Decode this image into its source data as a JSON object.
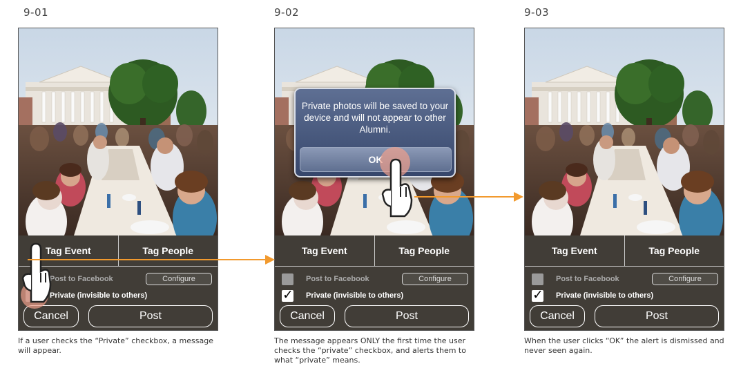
{
  "panels": [
    {
      "label": "9-01",
      "tag_event": "Tag Event",
      "tag_people": "Tag People",
      "post_to_facebook": "Post to Facebook",
      "configure": "Configure",
      "private": "Private (invisible to others)",
      "private_checked": false,
      "cancel": "Cancel",
      "post": "Post",
      "caption": "If a user checks the “Private” checkbox, a message will appear."
    },
    {
      "label": "9-02",
      "tag_event": "Tag Event",
      "tag_people": "Tag People",
      "post_to_facebook": "Post to Facebook",
      "configure": "Configure",
      "private": "Private (invisible to others)",
      "private_checked": true,
      "cancel": "Cancel",
      "post": "Post",
      "alert_message": "Private photos will be saved to your device and will not appear to other Alumni.",
      "alert_ok": "OK",
      "caption": "The message appears ONLY the first time the user checks the “private” checkbox, and alerts them to what “private” means."
    },
    {
      "label": "9-03",
      "tag_event": "Tag Event",
      "tag_people": "Tag People",
      "post_to_facebook": "Post to Facebook",
      "configure": "Configure",
      "private": "Private (invisible to others)",
      "private_checked": true,
      "cancel": "Cancel",
      "post": "Post",
      "caption": "When the user clicks “OK” the alert is dismissed and never seen again."
    }
  ],
  "colors": {
    "arrow": "#f29a2e",
    "touch": "#f0a08c",
    "alert_bg": "#4a5a80",
    "controls_bg": "#46423c"
  },
  "icons": [
    "pointing-hand-icon",
    "arrow-right-icon",
    "checkmark-icon"
  ]
}
